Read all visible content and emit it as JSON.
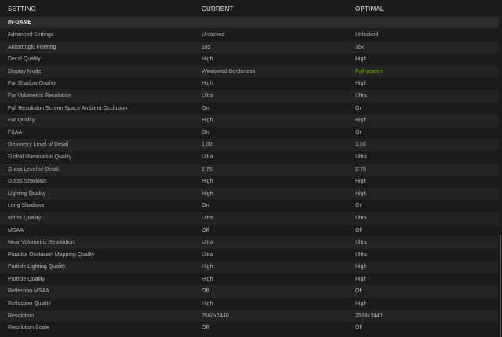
{
  "header": {
    "setting": "SETTING",
    "current": "CURRENT",
    "optimal": "OPTIMAL"
  },
  "section": {
    "title": "IN-GAME"
  },
  "rows": [
    {
      "setting": "Advanced Settings",
      "current": "Unlocked",
      "optimal": "Unlocked"
    },
    {
      "setting": "Anisotropic Filtering",
      "current": "16x",
      "optimal": "16x"
    },
    {
      "setting": "Decal Quality",
      "current": "High",
      "optimal": "High"
    },
    {
      "setting": "Display Mode",
      "current": "Windowed Borderless",
      "optimal": "Full-screen",
      "optimal_changed": true
    },
    {
      "setting": "Far Shadow Quality",
      "current": "High",
      "optimal": "High"
    },
    {
      "setting": "Far Volumetric Resolution",
      "current": "Ultra",
      "optimal": "Ultra"
    },
    {
      "setting": "Full Resolution Screen Space Ambient Occlusion",
      "current": "On",
      "optimal": "On"
    },
    {
      "setting": "Fur Quality",
      "current": "High",
      "optimal": "High"
    },
    {
      "setting": "FXAA",
      "current": "On",
      "optimal": "On"
    },
    {
      "setting": "Geometry Level of Detail",
      "current": "1.00",
      "optimal": "1.00"
    },
    {
      "setting": "Global Illumination Quality",
      "current": "Ultra",
      "optimal": "Ultra"
    },
    {
      "setting": "Grass Level of Detail",
      "current": "2.75",
      "optimal": "2.75"
    },
    {
      "setting": "Grass Shadows",
      "current": "High",
      "optimal": "High"
    },
    {
      "setting": "Lighting Quality",
      "current": "High",
      "optimal": "High"
    },
    {
      "setting": "Long Shadows",
      "current": "On",
      "optimal": "On"
    },
    {
      "setting": "Mirror Quality",
      "current": "Ultra",
      "optimal": "Ultra"
    },
    {
      "setting": "MSAA",
      "current": "Off",
      "optimal": "Off"
    },
    {
      "setting": "Near Volumetric Resolution",
      "current": "Ultra",
      "optimal": "Ultra"
    },
    {
      "setting": "Parallax Occlusion Mapping Quality",
      "current": "Ultra",
      "optimal": "Ultra"
    },
    {
      "setting": "Particle Lighting Quality",
      "current": "High",
      "optimal": "High"
    },
    {
      "setting": "Particle Quality",
      "current": "High",
      "optimal": "High"
    },
    {
      "setting": "Reflection MSAA",
      "current": "Off",
      "optimal": "Off"
    },
    {
      "setting": "Reflection Quality",
      "current": "High",
      "optimal": "High"
    },
    {
      "setting": "Resolution",
      "current": "2560x1440",
      "optimal": "2560x1440"
    },
    {
      "setting": "Resolution Scale",
      "current": "Off",
      "optimal": "Off"
    }
  ],
  "colors": {
    "changed_value": "#76b900",
    "text": "#b3b3b3",
    "header_text": "#e6e6e6",
    "background": "#1b1b1b",
    "row_alt": "#232323",
    "section_bg": "#2b2b2b"
  }
}
